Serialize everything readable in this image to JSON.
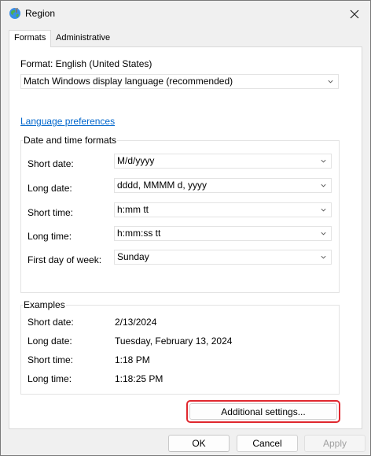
{
  "window": {
    "title": "Region"
  },
  "tabs": [
    {
      "label": "Formats"
    },
    {
      "label": "Administrative"
    }
  ],
  "format": {
    "label": "Format: English (United States)",
    "value": "Match Windows display language (recommended)"
  },
  "language_link": "Language preferences",
  "date_time": {
    "title": "Date and time formats",
    "rows": [
      {
        "label": "Short date:",
        "value": "M/d/yyyy"
      },
      {
        "label": "Long date:",
        "value": "dddd, MMMM d, yyyy"
      },
      {
        "label": "Short time:",
        "value": "h:mm tt"
      },
      {
        "label": "Long time:",
        "value": "h:mm:ss tt"
      },
      {
        "label": "First day of week:",
        "value": "Sunday"
      }
    ]
  },
  "examples": {
    "title": "Examples",
    "rows": [
      {
        "label": "Short date:",
        "value": "2/13/2024"
      },
      {
        "label": "Long date:",
        "value": "Tuesday, February 13, 2024"
      },
      {
        "label": "Short time:",
        "value": "1:18 PM"
      },
      {
        "label": "Long time:",
        "value": "1:18:25 PM"
      }
    ]
  },
  "buttons": {
    "additional": "Additional settings...",
    "ok": "OK",
    "cancel": "Cancel",
    "apply": "Apply"
  },
  "colors": {
    "link": "#0066cc",
    "highlight": "#e0282f"
  },
  "icons": {
    "app": "globe-icon",
    "close": "close-icon",
    "chevron": "chevron-down-icon"
  }
}
